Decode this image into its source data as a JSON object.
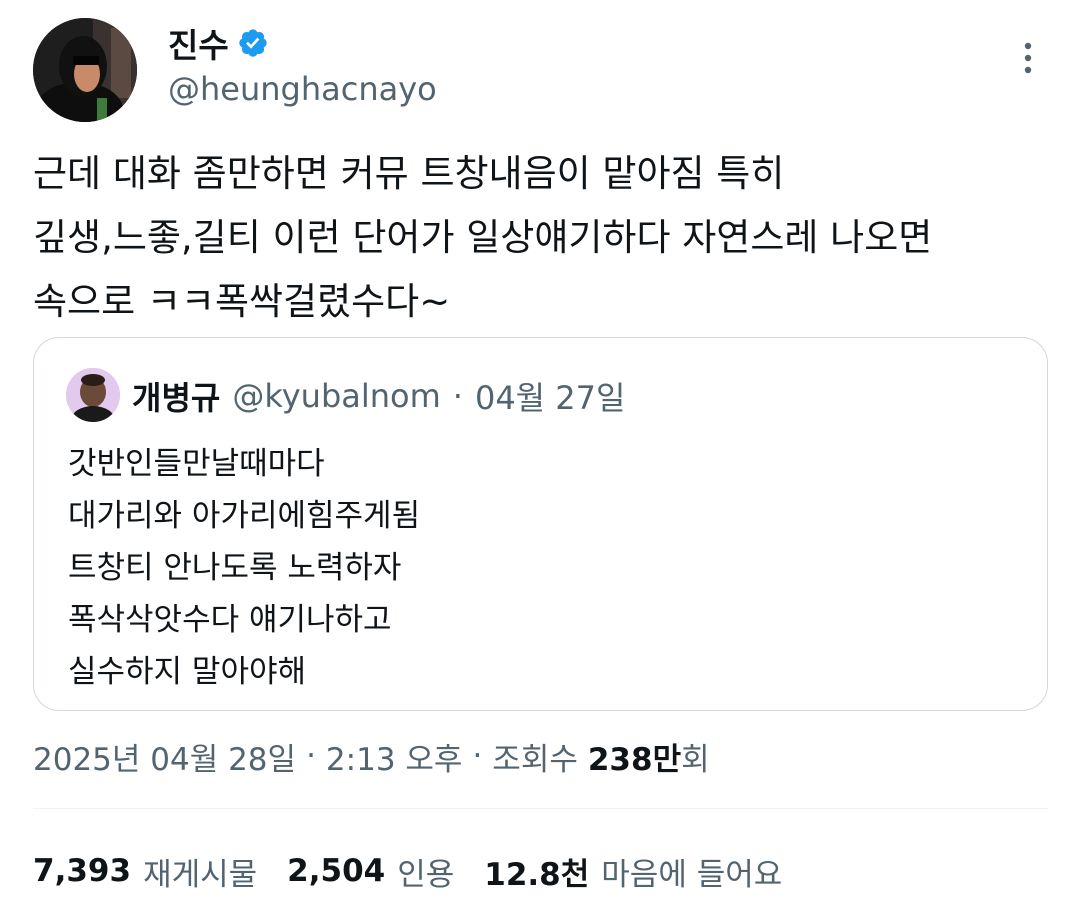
{
  "author": {
    "display_name": "진수",
    "handle": "@heunghacnayo",
    "verified": true
  },
  "tweet": {
    "lines": [
      "근데 대화 좀만하면 커뮤 트창내음이 맡아짐 특히",
      "깊생,느좋,길티 이런 단어가 일상얘기하다 자연스레 나오면",
      "속으로 ㅋㅋ폭싹걸렸수다~"
    ]
  },
  "quote": {
    "display_name": "개병규",
    "handle": "@kyubalnom",
    "separator": "·",
    "date": "04월 27일",
    "lines": [
      "갓반인들만날때마다",
      "대가리와 아가리에힘주게됨",
      "트창티 안나도록 노력하자",
      "폭삭삭앗수다 얘기나하고",
      "실수하지 말아야해"
    ]
  },
  "meta": {
    "date": "2025년 04월 28일",
    "sep1": "·",
    "time": "2:13 오후",
    "sep2": "·",
    "views_label": "조회수",
    "views_value": "238만",
    "views_suffix": "회"
  },
  "stats": {
    "reposts_value": "7,393",
    "reposts_label": "재게시물",
    "quotes_value": "2,504",
    "quotes_label": "인용",
    "likes_value": "12.8천",
    "likes_label": "마음에 들어요"
  },
  "colors": {
    "text_primary": "#0f1419",
    "text_secondary": "#536471",
    "verified_blue": "#1d9bf0",
    "border": "#cfd9de"
  },
  "icons": {
    "verified": "verified-badge-icon",
    "more": "more-horizontal-icon"
  }
}
